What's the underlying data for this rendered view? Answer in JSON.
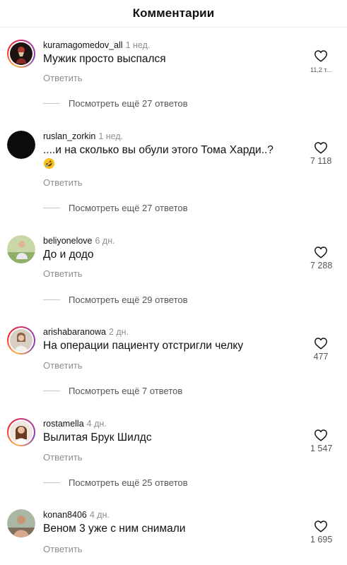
{
  "header": {
    "title": "Комментарии"
  },
  "reply_label": "Ответить",
  "comments": [
    {
      "username": "kuramagomedov_all",
      "time": "1 нед.",
      "text": "Мужик просто выспался",
      "likes": "11,2 т...",
      "more_replies": "Посмотреть ещё 27 ответов"
    },
    {
      "username": "ruslan_zorkin",
      "time": "1 нед.",
      "text": "....и на сколько вы обули этого Тома Харди..?",
      "emoji": "rolling-on-floor-laughing",
      "likes": "7 118",
      "more_replies": "Посмотреть ещё 27 ответов"
    },
    {
      "username": "beliyonelove",
      "time": "6 дн.",
      "text": "До и додо",
      "likes": "7 288",
      "more_replies": "Посмотреть ещё 29 ответов"
    },
    {
      "username": "arishabaranowa",
      "time": "2 дн.",
      "text": "На операции пациенту отстригли челку",
      "likes": "477",
      "more_replies": "Посмотреть ещё 7 ответов"
    },
    {
      "username": "rostamella",
      "time": "4 дн.",
      "text": "Вылитая Брук Шилдс",
      "likes": "1 547",
      "more_replies": "Посмотреть ещё 25 ответов"
    },
    {
      "username": "konan8406",
      "time": "4 дн.",
      "text": "Веном 3 уже с ним снимали",
      "likes": "1 695"
    }
  ]
}
